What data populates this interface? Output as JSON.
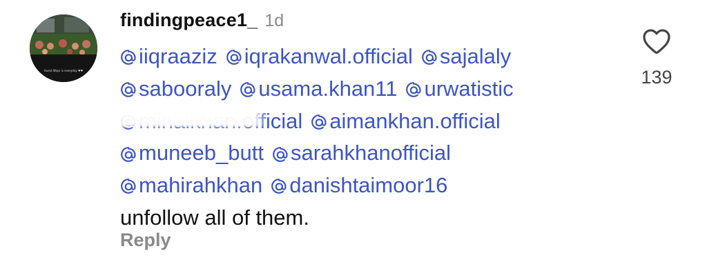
{
  "comment": {
    "username": "findingpeace1_",
    "time": "1d",
    "avatar_caption": "Guest Ways is everyday ♥♥",
    "lines": [
      [
        "@iiqraaziz",
        "@iqrakanwal.official",
        "@sajalaly"
      ],
      [
        "@sabooraly",
        "@usama.khan11",
        "@urwatistic"
      ],
      [
        "@minalkhan.official",
        "@aimankhan.official"
      ],
      [
        "@muneeb_butt",
        "@sarahkhanofficial"
      ],
      [
        "@mahirahkhan",
        "@danishtaimoor16"
      ]
    ],
    "text": "unfollow all of them.",
    "reply_label": "Reply",
    "like_count": "139",
    "icons": {
      "like": "heart-outline-icon",
      "mention": "threads-at-icon"
    },
    "colors": {
      "mention": "#3d55c6",
      "muted": "#8a8a8a",
      "text": "#111111"
    }
  }
}
